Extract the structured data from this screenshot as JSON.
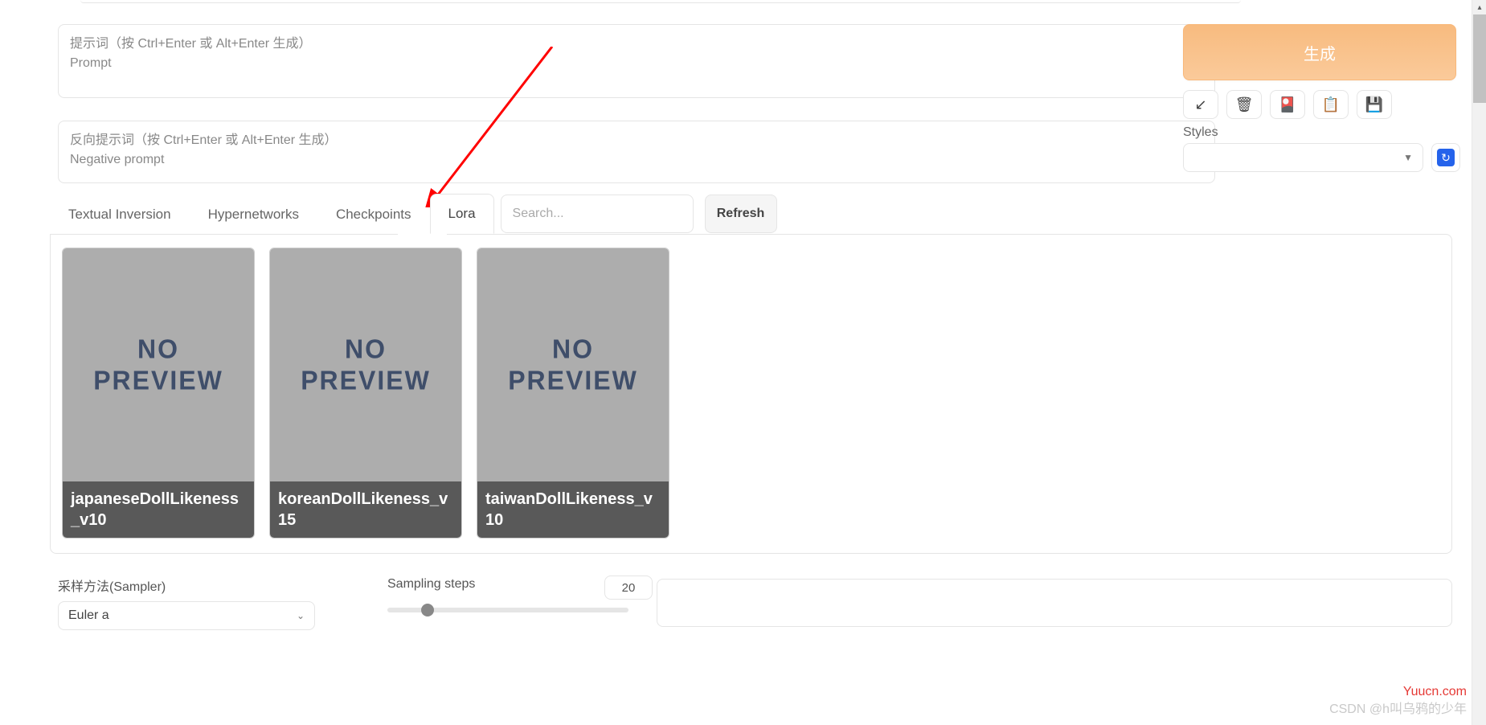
{
  "prompt": {
    "placeholder_line1": "提示词（按 Ctrl+Enter 或 Alt+Enter 生成）",
    "placeholder_line2": "Prompt"
  },
  "neg_prompt": {
    "placeholder_line1": "反向提示词（按 Ctrl+Enter 或 Alt+Enter 生成）",
    "placeholder_line2": "Negative prompt"
  },
  "generate_label": "生成",
  "styles_label": "Styles",
  "tabs": {
    "textual_inversion": "Textual Inversion",
    "hypernetworks": "Hypernetworks",
    "checkpoints": "Checkpoints",
    "lora": "Lora"
  },
  "search_placeholder": "Search...",
  "refresh_label": "Refresh",
  "cards": [
    {
      "name": "japaneseDollLikeness_v10",
      "preview_text": "NO\nPREVIEW"
    },
    {
      "name": "koreanDollLikeness_v15",
      "preview_text": "NO\nPREVIEW"
    },
    {
      "name": "taiwanDollLikeness_v10",
      "preview_text": "NO\nPREVIEW"
    }
  ],
  "sampler": {
    "label": "采样方法(Sampler)",
    "value": "Euler a"
  },
  "steps": {
    "label": "Sampling steps",
    "value": "20"
  },
  "watermark1": "Yuucn.com",
  "watermark2": "CSDN @h叫乌鸦的少年"
}
